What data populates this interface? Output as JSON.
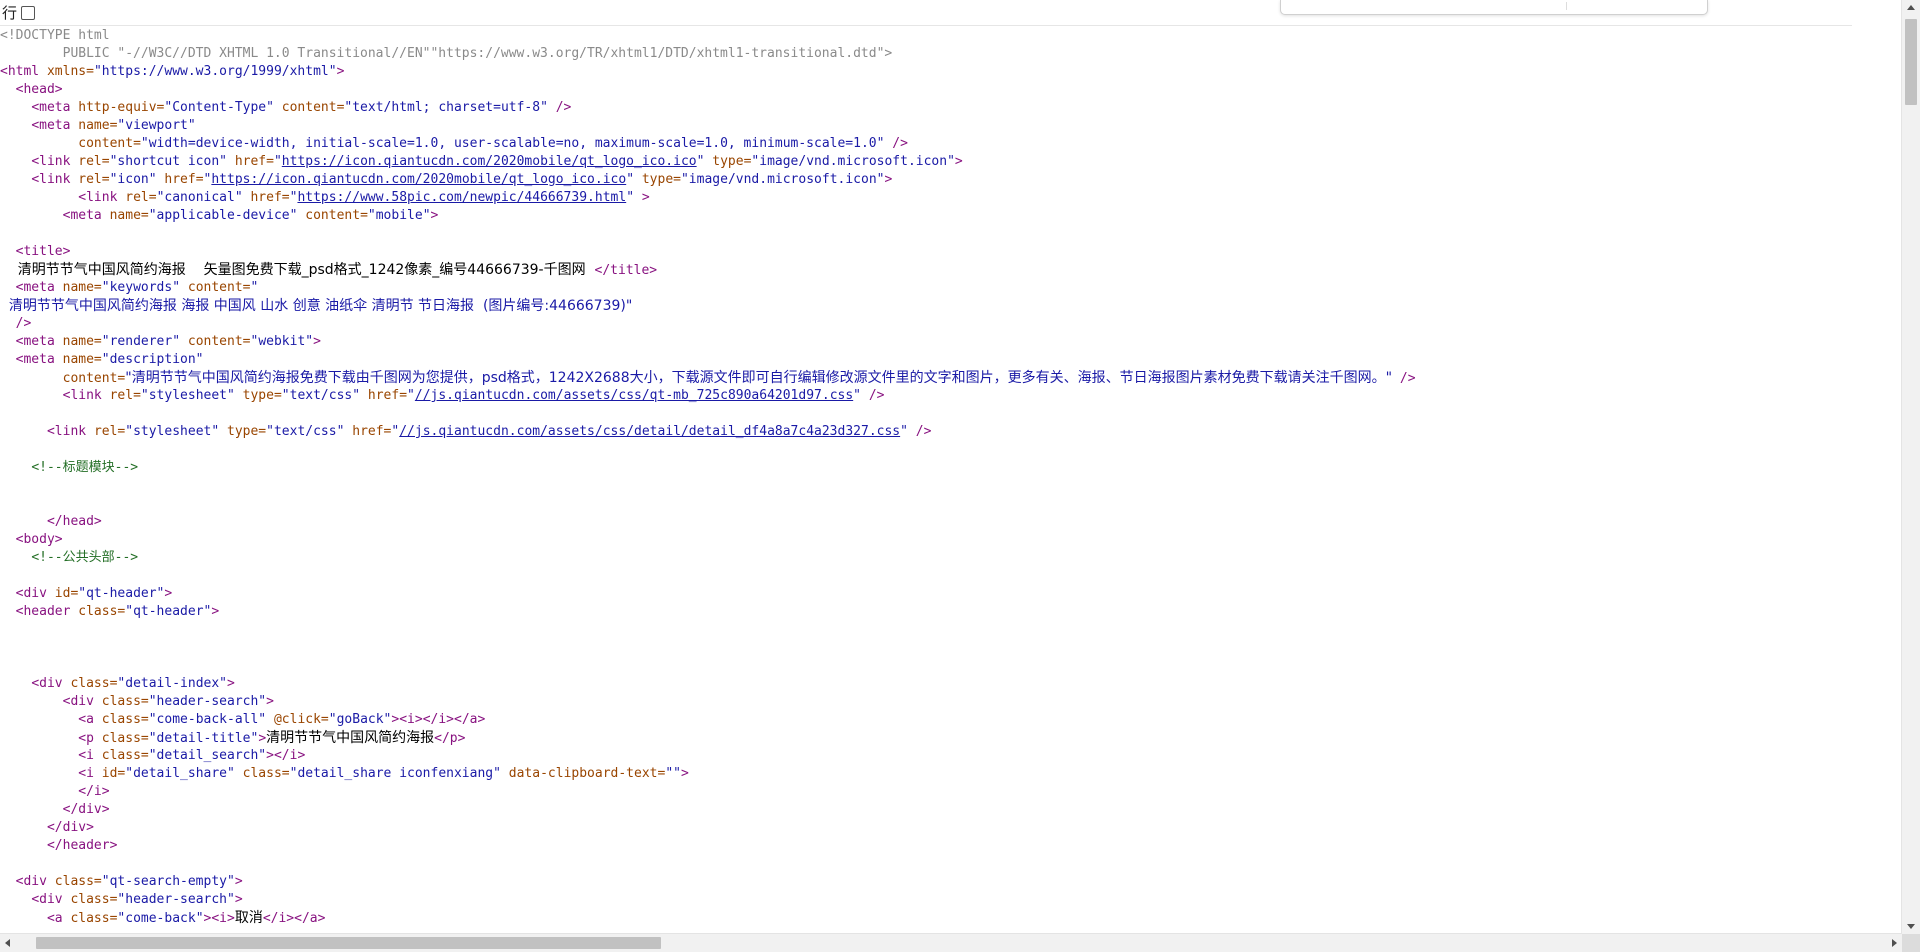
{
  "toolbar": {
    "line_wrap_label": "行",
    "line_wrap_checked": false
  },
  "source_lines": [
    [
      {
        "c": "dt",
        "t": "<!DOCTYPE html"
      }
    ],
    [
      {
        "c": "dt",
        "t": "        PUBLIC \"-//W3C//DTD XHTML 1.0 Transitional//EN\"\"https://www.w3.org/TR/xhtml1/DTD/xhtml1-transitional.dtd\">"
      }
    ],
    [
      {
        "c": "t",
        "t": "<html "
      },
      {
        "c": "a",
        "t": "xmlns="
      },
      {
        "c": "v",
        "t": "\"https://www.w3.org/1999/xhtml\""
      },
      {
        "c": "t",
        "t": ">"
      }
    ],
    [
      {
        "c": "p",
        "t": "  "
      },
      {
        "c": "t",
        "t": "<head>"
      }
    ],
    [
      {
        "c": "p",
        "t": "    "
      },
      {
        "c": "t",
        "t": "<meta "
      },
      {
        "c": "a",
        "t": "http-equiv="
      },
      {
        "c": "v",
        "t": "\"Content-Type\""
      },
      {
        "c": "a",
        "t": " content="
      },
      {
        "c": "v",
        "t": "\"text/html; charset=utf-8\""
      },
      {
        "c": "t",
        "t": " />"
      }
    ],
    [
      {
        "c": "p",
        "t": "    "
      },
      {
        "c": "t",
        "t": "<meta "
      },
      {
        "c": "a",
        "t": "name="
      },
      {
        "c": "v",
        "t": "\"viewport\""
      }
    ],
    [
      {
        "c": "p",
        "t": "          "
      },
      {
        "c": "a",
        "t": "content="
      },
      {
        "c": "v",
        "t": "\"width=device-width, initial-scale=1.0, user-scalable=no, maximum-scale=1.0, minimum-scale=1.0\""
      },
      {
        "c": "t",
        "t": " />"
      }
    ],
    [
      {
        "c": "p",
        "t": "    "
      },
      {
        "c": "t",
        "t": "<link "
      },
      {
        "c": "a",
        "t": "rel="
      },
      {
        "c": "v",
        "t": "\"shortcut icon\""
      },
      {
        "c": "a",
        "t": " href="
      },
      {
        "c": "v",
        "t": "\""
      },
      {
        "c": "lk",
        "t": "https://icon.qiantucdn.com/2020mobile/qt_logo_ico.ico"
      },
      {
        "c": "v",
        "t": "\""
      },
      {
        "c": "a",
        "t": " type="
      },
      {
        "c": "v",
        "t": "\"image/vnd.microsoft.icon\""
      },
      {
        "c": "t",
        "t": ">"
      }
    ],
    [
      {
        "c": "p",
        "t": "    "
      },
      {
        "c": "t",
        "t": "<link "
      },
      {
        "c": "a",
        "t": "rel="
      },
      {
        "c": "v",
        "t": "\"icon\""
      },
      {
        "c": "a",
        "t": " href="
      },
      {
        "c": "v",
        "t": "\""
      },
      {
        "c": "lk",
        "t": "https://icon.qiantucdn.com/2020mobile/qt_logo_ico.ico"
      },
      {
        "c": "v",
        "t": "\""
      },
      {
        "c": "a",
        "t": " type="
      },
      {
        "c": "v",
        "t": "\"image/vnd.microsoft.icon\""
      },
      {
        "c": "t",
        "t": ">"
      }
    ],
    [
      {
        "c": "p",
        "t": "          "
      },
      {
        "c": "t",
        "t": "<link "
      },
      {
        "c": "a",
        "t": "rel="
      },
      {
        "c": "v",
        "t": "\"canonical\""
      },
      {
        "c": "a",
        "t": " href="
      },
      {
        "c": "v",
        "t": "\""
      },
      {
        "c": "lk",
        "t": "https://www.58pic.com/newpic/44666739.html"
      },
      {
        "c": "v",
        "t": "\""
      },
      {
        "c": "t",
        "t": " >"
      }
    ],
    [
      {
        "c": "p",
        "t": "        "
      },
      {
        "c": "t",
        "t": "<meta "
      },
      {
        "c": "a",
        "t": "name="
      },
      {
        "c": "v",
        "t": "\"applicable-device\""
      },
      {
        "c": "a",
        "t": " content="
      },
      {
        "c": "v",
        "t": "\"mobile\""
      },
      {
        "c": "t",
        "t": ">"
      }
    ],
    [],
    [
      {
        "c": "p",
        "t": "  "
      },
      {
        "c": "t",
        "t": "<title>"
      }
    ],
    [
      {
        "c": "cjk",
        "t": "    清明节节气中国风简约海报    矢量图免费下载_psd格式_1242像素_编号44666739-千图网  "
      },
      {
        "c": "t",
        "t": "</title>"
      }
    ],
    [
      {
        "c": "p",
        "t": "  "
      },
      {
        "c": "t",
        "t": "<meta "
      },
      {
        "c": "a",
        "t": "name="
      },
      {
        "c": "v",
        "t": "\"keywords\""
      },
      {
        "c": "a",
        "t": " content="
      },
      {
        "c": "v",
        "t": "\""
      }
    ],
    [
      {
        "c": "vcjk",
        "t": "  清明节节气中国风简约海报 海报 中国风 山水 创意 油纸伞 清明节 节日海报  (图片编号:44666739)\""
      }
    ],
    [
      {
        "c": "p",
        "t": "  "
      },
      {
        "c": "t",
        "t": "/>"
      }
    ],
    [
      {
        "c": "p",
        "t": "  "
      },
      {
        "c": "t",
        "t": "<meta "
      },
      {
        "c": "a",
        "t": "name="
      },
      {
        "c": "v",
        "t": "\"renderer\""
      },
      {
        "c": "a",
        "t": " content="
      },
      {
        "c": "v",
        "t": "\"webkit\""
      },
      {
        "c": "t",
        "t": ">"
      }
    ],
    [
      {
        "c": "p",
        "t": "  "
      },
      {
        "c": "t",
        "t": "<meta "
      },
      {
        "c": "a",
        "t": "name="
      },
      {
        "c": "v",
        "t": "\"description\""
      }
    ],
    [
      {
        "c": "p",
        "t": "        "
      },
      {
        "c": "a",
        "t": "content="
      },
      {
        "c": "vcjk",
        "t": "\"清明节节气中国风简约海报免费下载由千图网为您提供，psd格式，1242X2688大小，下载源文件即可自行编辑修改源文件里的文字和图片，更多有关、海报、节日海报图片素材免费下载请关注千图网。\""
      },
      {
        "c": "t",
        "t": " />"
      }
    ],
    [
      {
        "c": "p",
        "t": "        "
      },
      {
        "c": "t",
        "t": "<link "
      },
      {
        "c": "a",
        "t": "rel="
      },
      {
        "c": "v",
        "t": "\"stylesheet\""
      },
      {
        "c": "a",
        "t": " type="
      },
      {
        "c": "v",
        "t": "\"text/css\""
      },
      {
        "c": "a",
        "t": " href="
      },
      {
        "c": "v",
        "t": "\""
      },
      {
        "c": "lk",
        "t": "//js.qiantucdn.com/assets/css/qt-mb_725c890a64201d97.css"
      },
      {
        "c": "v",
        "t": "\""
      },
      {
        "c": "t",
        "t": " />"
      }
    ],
    [],
    [
      {
        "c": "p",
        "t": "      "
      },
      {
        "c": "t",
        "t": "<link "
      },
      {
        "c": "a",
        "t": "rel="
      },
      {
        "c": "v",
        "t": "\"stylesheet\""
      },
      {
        "c": "a",
        "t": " type="
      },
      {
        "c": "v",
        "t": "\"text/css\""
      },
      {
        "c": "a",
        "t": " href="
      },
      {
        "c": "v",
        "t": "\""
      },
      {
        "c": "lk",
        "t": "//js.qiantucdn.com/assets/css/detail/detail_df4a8a7c4a23d327.css"
      },
      {
        "c": "v",
        "t": "\""
      },
      {
        "c": "t",
        "t": " />"
      }
    ],
    [],
    [
      {
        "c": "p",
        "t": "    "
      },
      {
        "c": "c",
        "t": "<!--标题模块-->"
      }
    ],
    [],
    [],
    [
      {
        "c": "p",
        "t": "      "
      },
      {
        "c": "t",
        "t": "</head>"
      }
    ],
    [
      {
        "c": "p",
        "t": "  "
      },
      {
        "c": "t",
        "t": "<body>"
      }
    ],
    [
      {
        "c": "p",
        "t": "    "
      },
      {
        "c": "c",
        "t": "<!--公共头部-->"
      }
    ],
    [],
    [
      {
        "c": "p",
        "t": "  "
      },
      {
        "c": "t",
        "t": "<div "
      },
      {
        "c": "a",
        "t": "id="
      },
      {
        "c": "v",
        "t": "\"qt-header\""
      },
      {
        "c": "t",
        "t": ">"
      }
    ],
    [
      {
        "c": "p",
        "t": "  "
      },
      {
        "c": "t",
        "t": "<header "
      },
      {
        "c": "a",
        "t": "class="
      },
      {
        "c": "v",
        "t": "\"qt-header\""
      },
      {
        "c": "t",
        "t": ">"
      }
    ],
    [],
    [],
    [],
    [
      {
        "c": "p",
        "t": "    "
      },
      {
        "c": "t",
        "t": "<div "
      },
      {
        "c": "a",
        "t": "class="
      },
      {
        "c": "v",
        "t": "\"detail-index\""
      },
      {
        "c": "t",
        "t": ">"
      }
    ],
    [
      {
        "c": "p",
        "t": "        "
      },
      {
        "c": "t",
        "t": "<div "
      },
      {
        "c": "a",
        "t": "class="
      },
      {
        "c": "v",
        "t": "\"header-search\""
      },
      {
        "c": "t",
        "t": ">"
      }
    ],
    [
      {
        "c": "p",
        "t": "          "
      },
      {
        "c": "t",
        "t": "<a "
      },
      {
        "c": "a",
        "t": "class="
      },
      {
        "c": "v",
        "t": "\"come-back-all\""
      },
      {
        "c": "a",
        "t": " @click="
      },
      {
        "c": "v",
        "t": "\"goBack\""
      },
      {
        "c": "t",
        "t": "><i></i></a>"
      }
    ],
    [
      {
        "c": "p",
        "t": "          "
      },
      {
        "c": "t",
        "t": "<p "
      },
      {
        "c": "a",
        "t": "class="
      },
      {
        "c": "v",
        "t": "\"detail-title\""
      },
      {
        "c": "t",
        "t": ">"
      },
      {
        "c": "cjk",
        "t": "清明节节气中国风简约海报"
      },
      {
        "c": "t",
        "t": "</p>"
      }
    ],
    [
      {
        "c": "p",
        "t": "          "
      },
      {
        "c": "t",
        "t": "<i "
      },
      {
        "c": "a",
        "t": "class="
      },
      {
        "c": "v",
        "t": "\"detail_search\""
      },
      {
        "c": "t",
        "t": "></i>"
      }
    ],
    [
      {
        "c": "p",
        "t": "          "
      },
      {
        "c": "t",
        "t": "<i "
      },
      {
        "c": "a",
        "t": "id="
      },
      {
        "c": "v",
        "t": "\"detail_share\""
      },
      {
        "c": "a",
        "t": " class="
      },
      {
        "c": "v",
        "t": "\"detail_share iconfenxiang\""
      },
      {
        "c": "a",
        "t": " data-clipboard-text="
      },
      {
        "c": "v",
        "t": "\"\""
      },
      {
        "c": "t",
        "t": ">"
      }
    ],
    [
      {
        "c": "p",
        "t": "          "
      },
      {
        "c": "t",
        "t": "</i>"
      }
    ],
    [
      {
        "c": "p",
        "t": "        "
      },
      {
        "c": "t",
        "t": "</div>"
      }
    ],
    [
      {
        "c": "p",
        "t": "      "
      },
      {
        "c": "t",
        "t": "</div>"
      }
    ],
    [
      {
        "c": "p",
        "t": "      "
      },
      {
        "c": "t",
        "t": "</header>"
      }
    ],
    [],
    [
      {
        "c": "p",
        "t": "  "
      },
      {
        "c": "t",
        "t": "<div "
      },
      {
        "c": "a",
        "t": "class="
      },
      {
        "c": "v",
        "t": "\"qt-search-empty\""
      },
      {
        "c": "t",
        "t": ">"
      }
    ],
    [
      {
        "c": "p",
        "t": "    "
      },
      {
        "c": "t",
        "t": "<div "
      },
      {
        "c": "a",
        "t": "class="
      },
      {
        "c": "v",
        "t": "\"header-search\""
      },
      {
        "c": "t",
        "t": ">"
      }
    ],
    [
      {
        "c": "p",
        "t": "      "
      },
      {
        "c": "t",
        "t": "<a "
      },
      {
        "c": "a",
        "t": "class="
      },
      {
        "c": "v",
        "t": "\"come-back\""
      },
      {
        "c": "t",
        "t": "><i>"
      },
      {
        "c": "cjk",
        "t": "取消"
      },
      {
        "c": "t",
        "t": "</i></a>"
      }
    ]
  ],
  "colors": {
    "tag": "#881280",
    "attr_name": "#994500",
    "attr_value": "#1a1aa6",
    "comment": "#236e25",
    "doctype": "#8a8a8a"
  }
}
